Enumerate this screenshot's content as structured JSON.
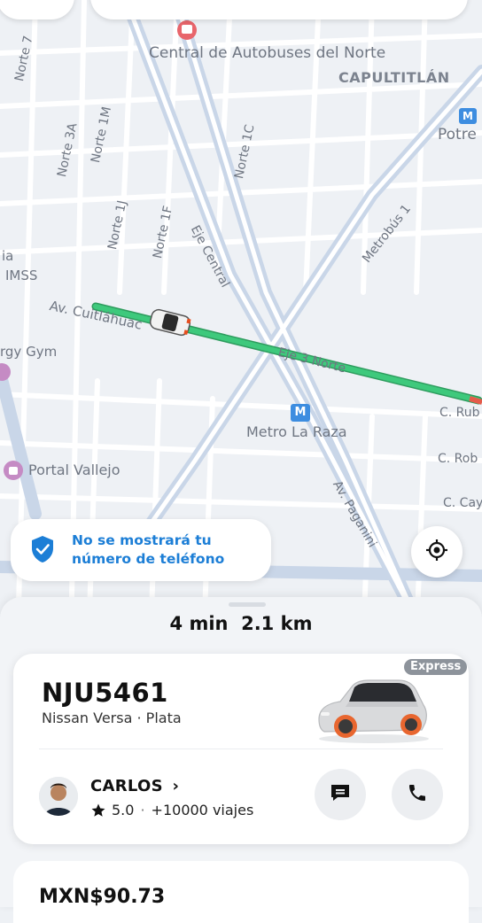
{
  "map": {
    "labels": {
      "central": "Central de Autobuses del Norte",
      "capultitlan": "CAPULTITLÁN",
      "potrero": "Potre",
      "norte7": "Norte 7",
      "norte3a": "Norte 3A",
      "norte1m": "Norte 1M",
      "norte1j": "Norte 1J",
      "norte1f": "Norte 1F",
      "norte1c": "Norte 1C",
      "eje_central": "Eje Central",
      "metrobus": "Metrobús 1",
      "imss": "IMSS",
      "imss_prefix": "ia",
      "cuitlahuac": "Av. Cuitláhuac",
      "eje3": "Eje 3 Norte",
      "gym": "rgy Gym",
      "metro_raza": "Metro La Raza",
      "portal": "Portal Vallejo",
      "c_rub": "C. Rub",
      "c_rob": "C. Rob",
      "c_cay": "C. Cay",
      "paganini": "Av. Paganini"
    },
    "metro_icon_letter": "M"
  },
  "privacy_notice": {
    "text": "No se mostrará tu número de teléfono",
    "icon": "shield-check-icon"
  },
  "trip": {
    "eta": "4 min",
    "distance": "2.1 km"
  },
  "vehicle": {
    "plate": "NJU5461",
    "model": "Nissan Versa",
    "separator": "·",
    "color": "Plata",
    "service": "Express"
  },
  "driver": {
    "name": "CARLOS",
    "chevron": "›",
    "rating": "5.0",
    "dot": "·",
    "trips": "+10000 viajes"
  },
  "price": "MXN$90.73",
  "colors": {
    "route": "#3ec97c",
    "accent_blue": "#1c7ed6",
    "badge_gray": "#8d939b",
    "map_bg": "#eef1f5",
    "road_major": "#c9d2e0"
  }
}
